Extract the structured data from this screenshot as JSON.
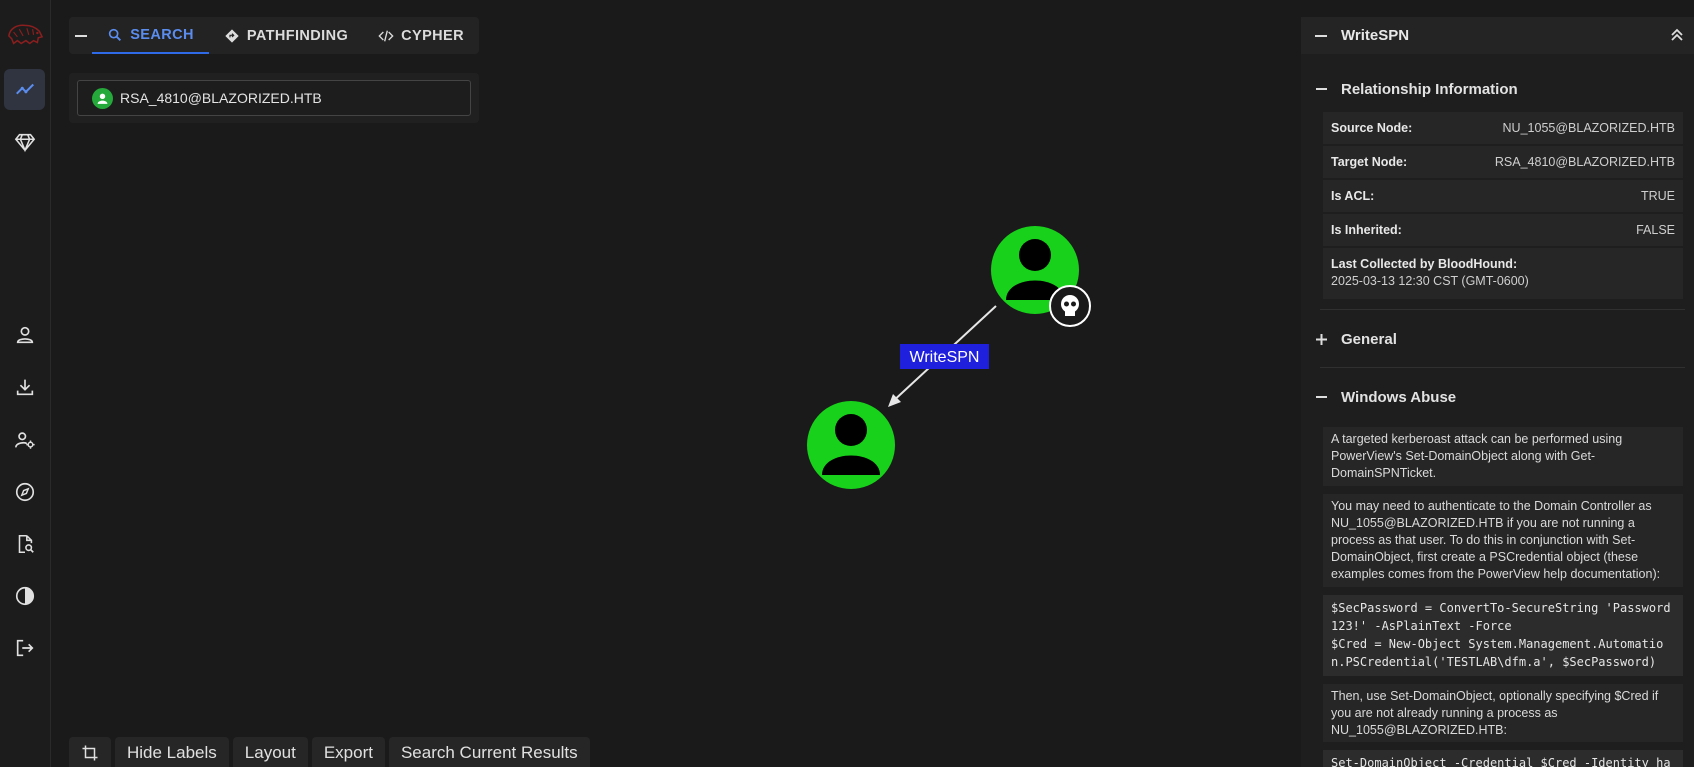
{
  "tabs": [
    {
      "label": "SEARCH",
      "icon": "search-icon"
    },
    {
      "label": "PATHFINDING",
      "icon": "diamond-route-icon"
    },
    {
      "label": "CYPHER",
      "icon": "code-icon"
    }
  ],
  "search": {
    "value": "RSA_4810@BLAZORIZED.HTB"
  },
  "graph": {
    "edge_label": "WriteSPN",
    "source_node": "NU_1055@BLAZORIZED.HTB",
    "target_node": "RSA_4810@BLAZORIZED.HTB",
    "node_color": "#18d11b",
    "edge_label_bg": "#1f1fde"
  },
  "toolbar": {
    "hide_labels": "Hide Labels",
    "layout": "Layout",
    "export": "Export",
    "search_current": "Search Current Results"
  },
  "panel": {
    "title": "WriteSPN",
    "relationship": {
      "title": "Relationship Information",
      "source_label": "Source Node:",
      "source_value": "NU_1055@BLAZORIZED.HTB",
      "target_label": "Target Node:",
      "target_value": "RSA_4810@BLAZORIZED.HTB",
      "acl_label": "Is ACL:",
      "acl_value": "TRUE",
      "inherited_label": "Is Inherited:",
      "inherited_value": "FALSE",
      "collected_label": "Last Collected by BloodHound:",
      "collected_value": "2025-03-13 12:30 CST (GMT-0600)"
    },
    "general": {
      "title": "General"
    },
    "windows_abuse": {
      "title": "Windows Abuse",
      "p1": "A targeted kerberoast attack can be performed using PowerView's Set-DomainObject along with Get-DomainSPNTicket.",
      "p2": "You may need to authenticate to the Domain Controller as NU_1055@BLAZORIZED.HTB if you are not running a process as that user. To do this in conjunction with Set-DomainObject, first create a PSCredential object (these examples comes from the PowerView help documentation):",
      "code1": "$SecPassword = ConvertTo-SecureString 'Password\n123!' -AsPlainText -Force\n$Cred = New-Object System.Management.Automatio\nn.PSCredential('TESTLAB\\dfm.a', $SecPassword)",
      "p3": "Then, use Set-DomainObject, optionally specifying $Cred if you are not already running a process as NU_1055@BLAZORIZED.HTB:",
      "code2": "Set-DomainObject -Credential $Cred -Identity ha"
    }
  }
}
